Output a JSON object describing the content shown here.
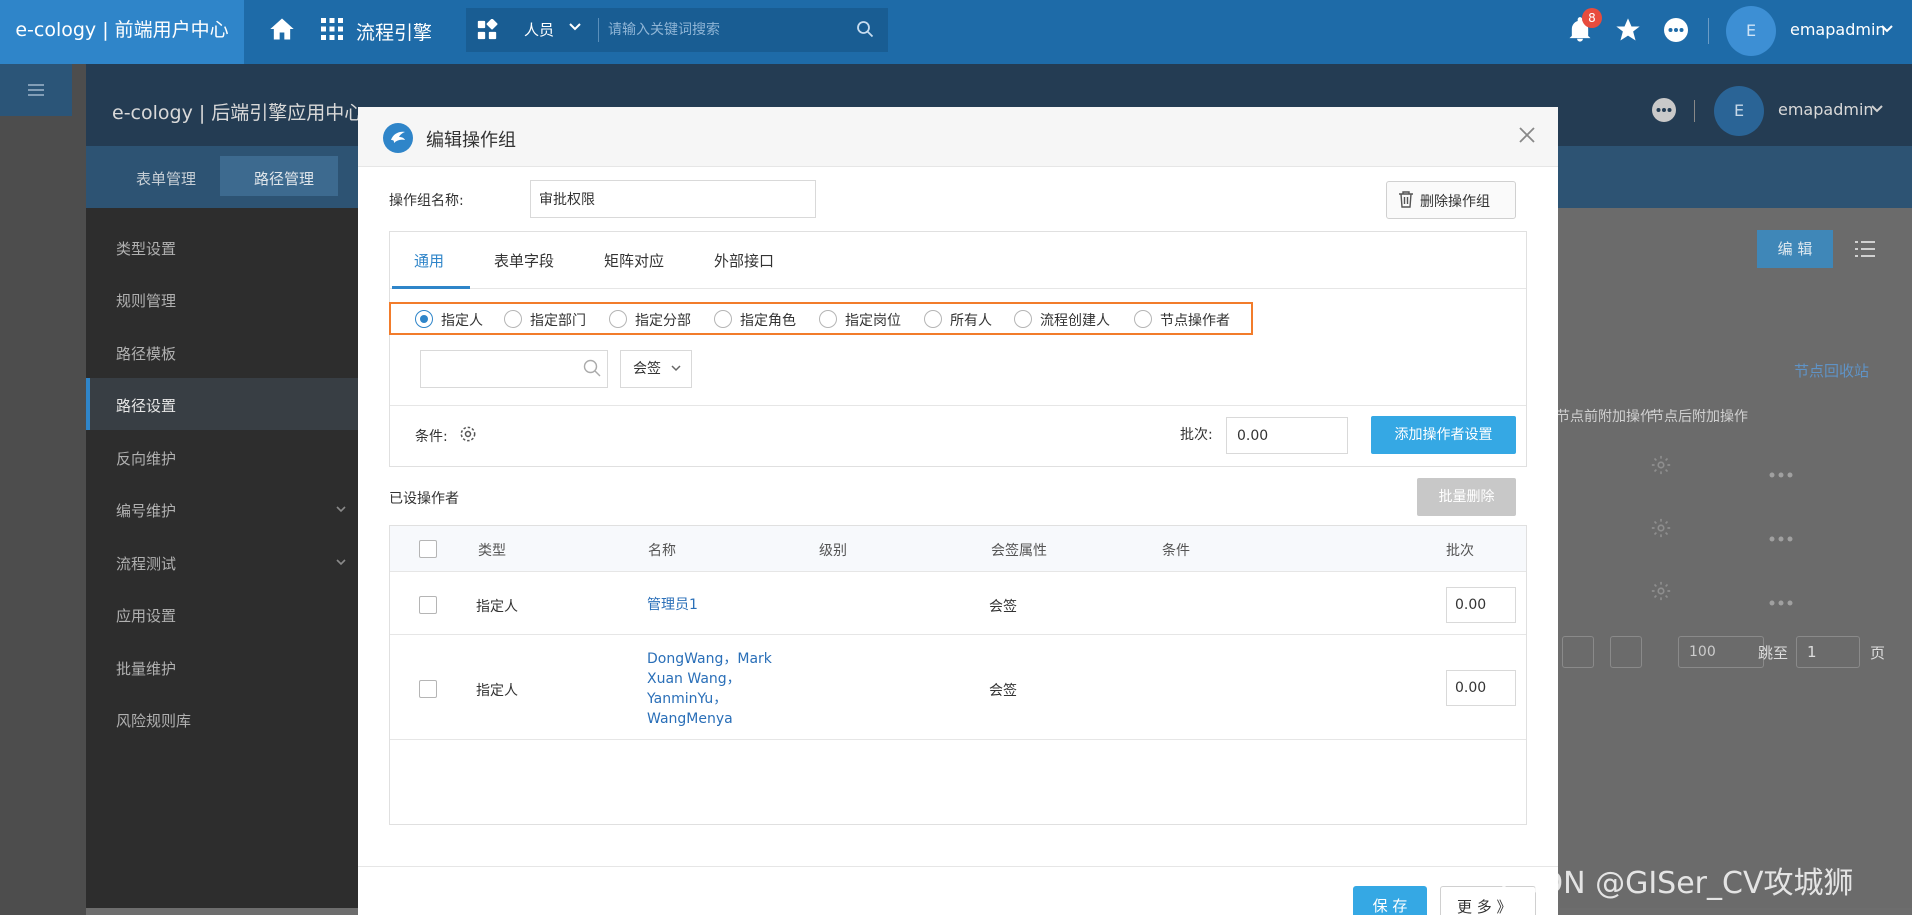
{
  "topbar": {
    "brand": "e-cology | 前端用户中心",
    "engine_label": "流程引擎",
    "search_scope": "人员",
    "search_placeholder": "请输入关键词搜索",
    "notification_count": "8",
    "username": "emapadmin",
    "avatar_letter": "E"
  },
  "inner": {
    "brand": "e-cology | 后端引擎应用中心",
    "username": "emapadmin",
    "avatar_letter": "E",
    "subtabs": [
      "表单管理",
      "路径管理"
    ],
    "sidebar": [
      {
        "label": "类型设置"
      },
      {
        "label": "规则管理"
      },
      {
        "label": "路径模板"
      },
      {
        "label": "路径设置",
        "active": true
      },
      {
        "label": "反向维护"
      },
      {
        "label": "编号维护",
        "expandable": true
      },
      {
        "label": "流程测试",
        "expandable": true
      },
      {
        "label": "应用设置"
      },
      {
        "label": "批量维护"
      },
      {
        "label": "风险规则库"
      }
    ],
    "edit_button": "编 辑",
    "recycle_link": "节点回收站",
    "col_pre_ops": "节点前附加操作",
    "col_post_ops": "节点后附加操作",
    "page_size": "100",
    "jump_label": "跳至",
    "jump_value": "1",
    "page_unit": "页"
  },
  "modal": {
    "title": "编辑操作组",
    "name_label": "操作组名称:",
    "name_value": "审批权限",
    "delete_group": "删除操作组",
    "tabs": [
      "通用",
      "表单字段",
      "矩阵对应",
      "外部接口"
    ],
    "radios": [
      "指定人",
      "指定部门",
      "指定分部",
      "指定角色",
      "指定岗位",
      "所有人",
      "流程创建人",
      "节点操作者"
    ],
    "selected_radio": "指定人",
    "sign_type": "会签",
    "condition_label": "条件:",
    "batch_label": "批次:",
    "batch_value": "0.00",
    "add_operator": "添加操作者设置",
    "set_operators": "已设操作者",
    "bulk_delete": "批量删除",
    "table": {
      "headers": [
        "类型",
        "名称",
        "级别",
        "会签属性",
        "条件",
        "批次"
      ],
      "rows": [
        {
          "type": "指定人",
          "name_lines": [
            "管理员1"
          ],
          "sign": "会签",
          "batch": "0.00"
        },
        {
          "type": "指定人",
          "name_lines": [
            "DongWang，Mark",
            "Xuan Wang，",
            "YanminYu，",
            "WangMenya"
          ],
          "sign": "会签",
          "batch": "0.00"
        }
      ]
    },
    "save": "保 存",
    "more": "更 多 》"
  },
  "watermark": "CSDN @GISer_CV攻城狮",
  "colors": {
    "primary": "#2f85c9",
    "button": "#35a8e4",
    "highlight_border": "#f27c2b",
    "badge": "#e84c3d"
  }
}
